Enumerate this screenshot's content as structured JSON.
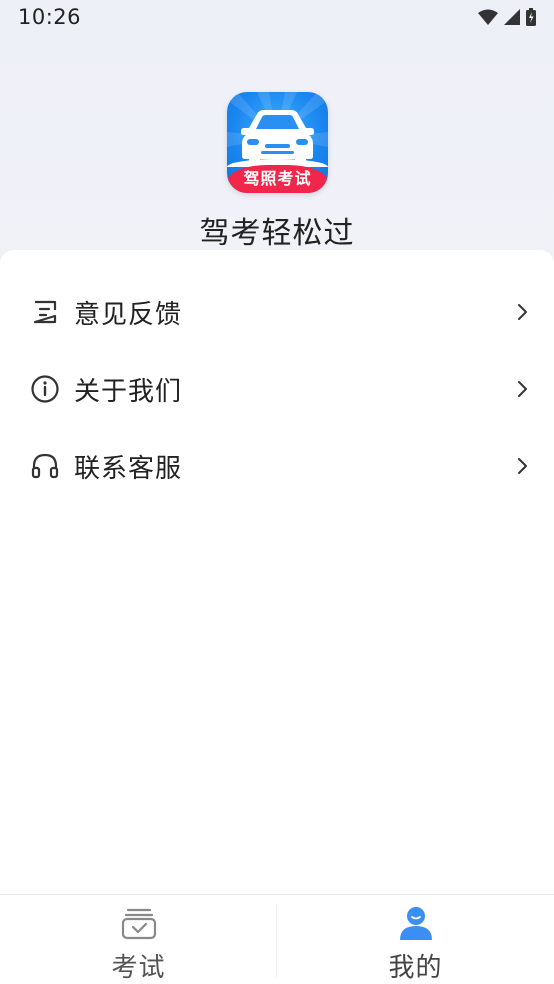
{
  "status_bar": {
    "time": "10:26"
  },
  "header": {
    "logo_ribbon_text": "驾照考试",
    "app_name": "驾考轻松过"
  },
  "menu": {
    "items": [
      {
        "label": "意见反馈",
        "icon": "edit-note-icon"
      },
      {
        "label": "关于我们",
        "icon": "info-circle-icon"
      },
      {
        "label": "联系客服",
        "icon": "headset-icon"
      }
    ]
  },
  "tabbar": {
    "tabs": [
      {
        "label": "考试",
        "icon": "exam-box-icon",
        "active": false
      },
      {
        "label": "我的",
        "icon": "user-icon",
        "active": true
      }
    ]
  },
  "colors": {
    "accent": "#3b8ff3",
    "ribbon": "#f0264a",
    "logo_blue": "#1a86f0"
  }
}
